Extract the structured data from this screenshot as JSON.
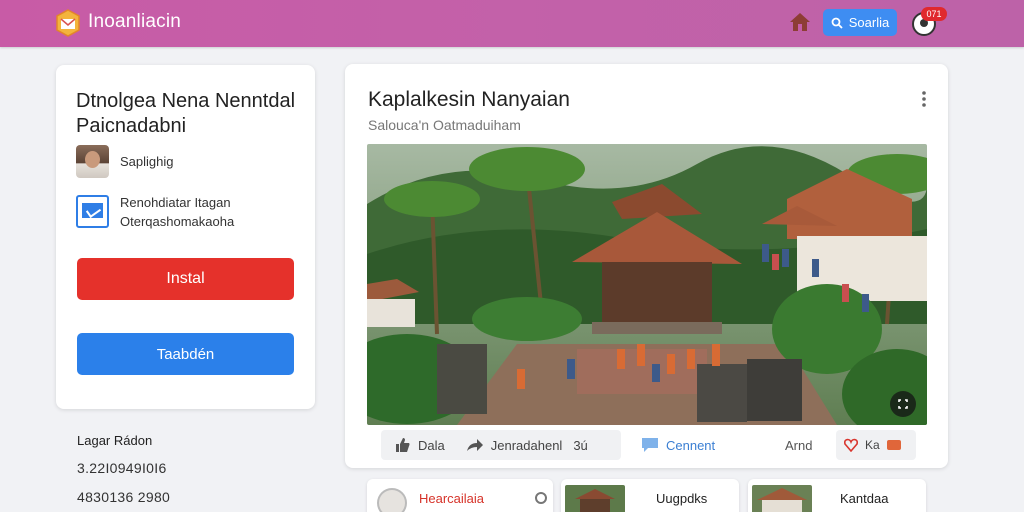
{
  "header": {
    "brand": "Inoanliacin",
    "search_label": "Soarlia",
    "notification_count": "071",
    "brand_color": "#c45ea8",
    "icons": [
      "logo-icon",
      "home-icon",
      "search-icon",
      "avatar"
    ]
  },
  "left_card": {
    "title": "Dtnolgea Nena Nenntdal Paicnadabni",
    "profile_label": "Saplighig",
    "info_line1": "Renohdiatar Itagan",
    "info_line2": "Oterqashomakaoha",
    "install_label": "Instal",
    "secondary_label": "Taabdén",
    "install_color": "#e5312b",
    "secondary_color": "#2b80ea"
  },
  "stats": {
    "title": "Lagar Rádon",
    "line1": "3.22I0949I0I6",
    "line2": "4830136 2980"
  },
  "post": {
    "title": "Kaplalkesin Nanyaian",
    "subtitle": "Salouca'n Oatmaduiham",
    "actions": {
      "like": "Dala",
      "share": "Jenradahenl",
      "share_count": "3ú",
      "comment": "Cennent",
      "amd": "Arnd",
      "react": "Ka"
    }
  },
  "related": [
    {
      "label": "Hearcailaia"
    },
    {
      "label": "Uugpdks"
    },
    {
      "label": "Kantdaa"
    }
  ]
}
